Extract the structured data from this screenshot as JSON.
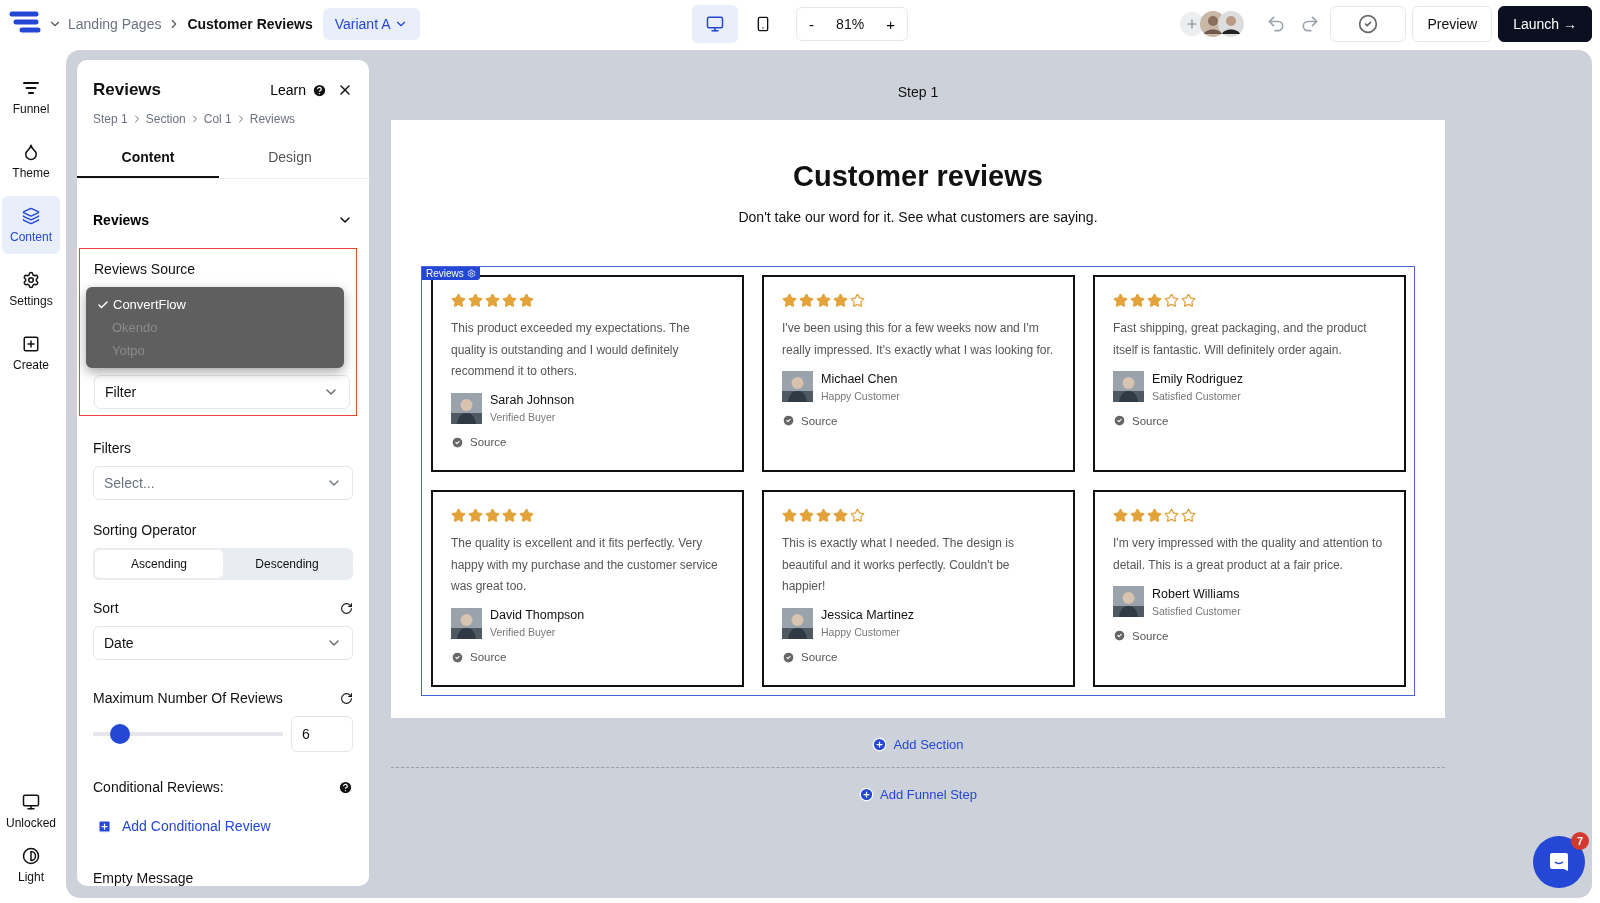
{
  "topbar": {
    "breadcrumb": [
      {
        "label": "Landing Pages",
        "current": false
      },
      {
        "label": "Customer Reviews",
        "current": true
      }
    ],
    "variant": "Variant A",
    "devices": [
      {
        "kind": "desktop",
        "selected": true
      },
      {
        "kind": "mobile",
        "selected": false
      }
    ],
    "zoom": {
      "minus": "-",
      "value": "81%",
      "plus": "+"
    },
    "buttons": [
      {
        "kind": "secondary",
        "label": "Preview"
      },
      {
        "kind": "primary",
        "label": "Launch →"
      }
    ]
  },
  "rail": {
    "items": [
      {
        "kind": "funnel",
        "label": "Funnel",
        "selected": false
      },
      {
        "kind": "theme",
        "label": "Theme",
        "selected": false
      },
      {
        "kind": "content",
        "label": "Content",
        "selected": true
      },
      {
        "kind": "settings",
        "label": "Settings",
        "selected": false
      },
      {
        "kind": "create",
        "label": "Create",
        "selected": false
      }
    ],
    "bottom": [
      {
        "kind": "monitor",
        "label": "Unlocked"
      },
      {
        "kind": "contrast",
        "label": "Light"
      }
    ]
  },
  "panel": {
    "title": "Reviews",
    "learn": "Learn",
    "path": [
      "Step 1",
      "Section",
      "Col 1",
      "Reviews"
    ],
    "tabs": [
      {
        "label": "Content",
        "selected": true
      },
      {
        "label": "Design",
        "selected": false
      }
    ],
    "section": "Reviews",
    "source": {
      "label": "Reviews Source",
      "options": [
        {
          "label": "ConvertFlow",
          "selected": true,
          "disabled": false
        },
        {
          "label": "Okendo",
          "selected": false,
          "disabled": true
        },
        {
          "label": "Yotpo",
          "selected": false,
          "disabled": true
        }
      ],
      "mode": "Filter"
    },
    "filters": {
      "label": "Filters",
      "placeholder": "Select..."
    },
    "sorting": {
      "label": "Sorting Operator",
      "options": [
        {
          "label": "Ascending",
          "selected": true
        },
        {
          "label": "Descending",
          "selected": false
        }
      ]
    },
    "sort": {
      "label": "Sort",
      "value": "Date"
    },
    "max": {
      "label": "Maximum Number Of Reviews",
      "level": 0.1,
      "value": "6"
    },
    "conditional": {
      "label": "Conditional Reviews:",
      "action": "Add Conditional Review"
    },
    "empty": "Empty Message"
  },
  "canvas": {
    "step": "Step 1",
    "heading": "Customer reviews",
    "subheading": "Don't take our word for it. See what customers are saying.",
    "tag": "Reviews",
    "reviews": [
      {
        "stars": 5,
        "text": "This product exceeded my expectations. The quality is outstanding and I would definitely recommend it to others.",
        "name": "Sarah Johnson",
        "role": "Verified Buyer",
        "source": "Source"
      },
      {
        "stars": 4,
        "text": "I've been using this for a few weeks now and I'm really impressed. It's exactly what I was looking for.",
        "name": "Michael Chen",
        "role": "Happy Customer",
        "source": "Source"
      },
      {
        "stars": 3,
        "text": "Fast shipping, great packaging, and the product itself is fantastic. Will definitely order again.",
        "name": "Emily Rodriguez",
        "role": "Satisfied Customer",
        "source": "Source"
      },
      {
        "stars": 5,
        "text": "The quality is excellent and it fits perfectly. Very happy with my purchase and the customer service was great too.",
        "name": "David Thompson",
        "role": "Verified Buyer",
        "source": "Source"
      },
      {
        "stars": 4,
        "text": "This is exactly what I needed. The design is beautiful and it works perfectly. Couldn't be happier!",
        "name": "Jessica Martinez",
        "role": "Happy Customer",
        "source": "Source"
      },
      {
        "stars": 3,
        "text": "I'm very impressed with the quality and attention to detail. This is a great product at a fair price.",
        "name": "Robert Williams",
        "role": "Satisfied Customer",
        "source": "Source"
      }
    ],
    "add_section": "Add Section",
    "add_step": "Add Funnel Step",
    "chat_badge": "7"
  }
}
